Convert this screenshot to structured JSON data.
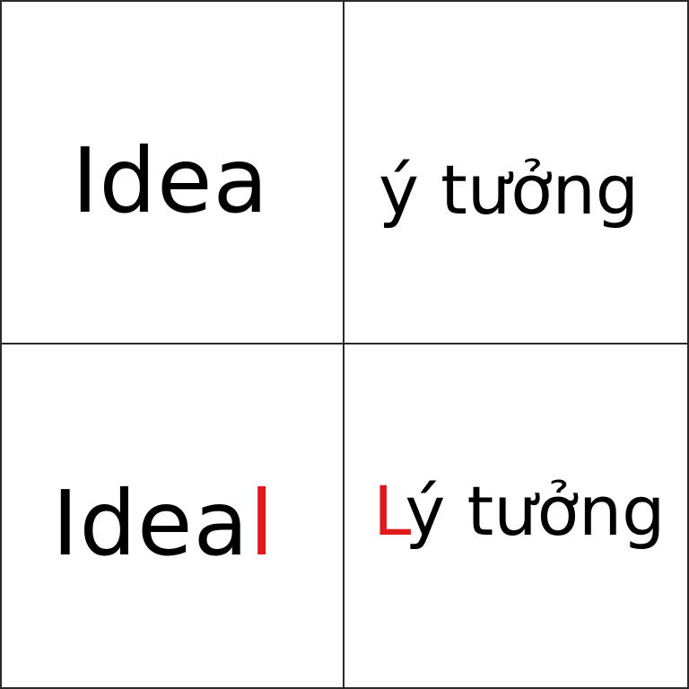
{
  "cells": {
    "top_left": {
      "text": "Idea"
    },
    "top_right": {
      "text": "ý tưởng"
    },
    "bottom_left": {
      "prefix": "Idea",
      "highlight": "l"
    },
    "bottom_right": {
      "highlight": "L",
      "suffix": "ý tưởng"
    }
  },
  "colors": {
    "text": "#000000",
    "highlight": "#e0191c",
    "border": "#2a2a2a",
    "background": "#ffffff"
  }
}
